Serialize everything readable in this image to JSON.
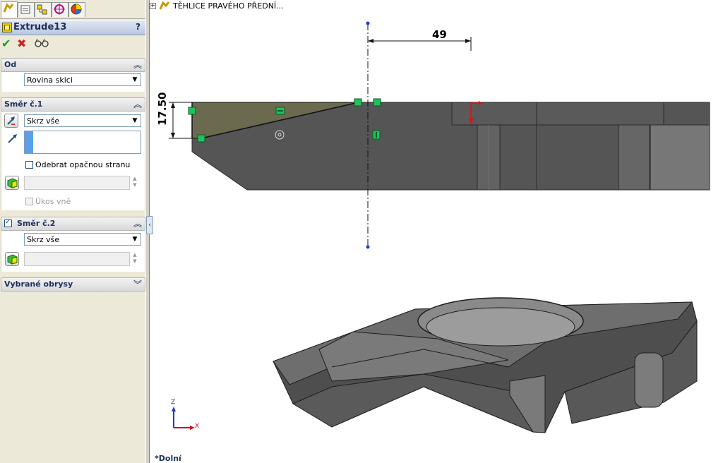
{
  "feature": {
    "title": "Extrude13",
    "help": "?"
  },
  "actions": {
    "ok": "✔",
    "cancel": "✖",
    "preview": "66"
  },
  "from_group": {
    "title": "Od",
    "value": "Rovina skici"
  },
  "direction1": {
    "title": "Směr č.1",
    "end_condition": "Skrz vše",
    "flip_side_label": "Odebrat opačnou stranu",
    "draft_label": "Úkos vně"
  },
  "direction2": {
    "title": "Směr č.2",
    "end_condition": "Skrz vše"
  },
  "contours_group": {
    "title": "Vybrané obrysy"
  },
  "tree": {
    "node_label": "TĚHLICE PRAVÉHO PŘEDNÍ..."
  },
  "viewport": {
    "dimension_horizontal": "49",
    "dimension_vertical": "17.50",
    "view_name": "*Dolní",
    "triad_z": "Z",
    "triad_x": "X"
  },
  "colors": {
    "accent": "#1c2f5a",
    "part_gray": "#555555",
    "sketch_region": "#6b6a4e",
    "relation_green": "#1fc25a"
  }
}
